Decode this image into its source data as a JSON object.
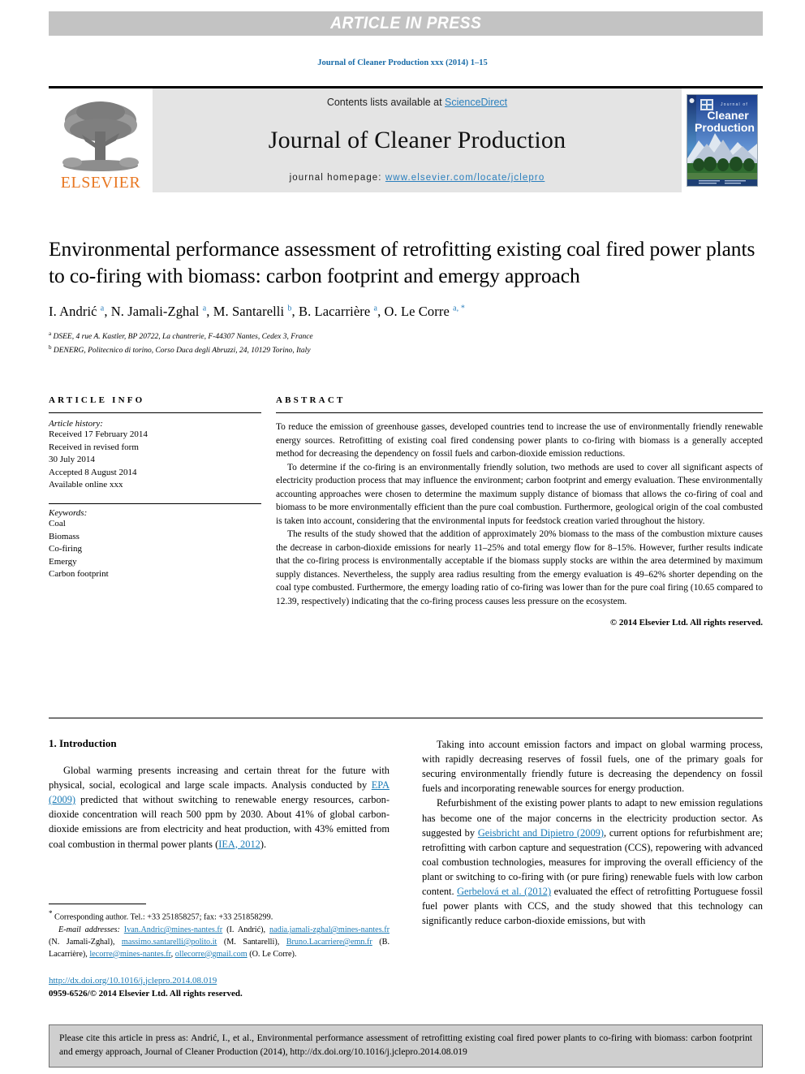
{
  "banner": {
    "label": "ARTICLE IN PRESS"
  },
  "running_head": "Journal of Cleaner Production xxx (2014) 1–15",
  "masthead": {
    "contents_prefix": "Contents lists available at ",
    "sciencedirect": "ScienceDirect",
    "journal_name": "Journal of Cleaner Production",
    "homepage_prefix": "journal homepage: ",
    "homepage_url": "www.elsevier.com/locate/jclepro",
    "publisher_logo_text": "ELSEVIER",
    "cover_title_small": "Journal of",
    "cover_title_line1": "Cleaner",
    "cover_title_line2": "Production"
  },
  "article": {
    "title": "Environmental performance assessment of retrofitting existing coal fired power plants to co-firing with biomass: carbon footprint and emergy approach",
    "authors_html": "I. Andrić <sup>a</sup>, N. Jamali-Zghal <sup>a</sup>, M. Santarelli <sup>b</sup>, B. Lacarrière <sup>a</sup>, O. Le Corre <sup>a, *</sup>",
    "affiliation_a": "DSEE, 4 rue A. Kastler, BP 20722, La chantrerie, F-44307 Nantes, Cedex 3, France",
    "affiliation_b": "DENERG, Politecnico di torino, Corso Duca degli Abruzzi, 24, 10129 Torino, Italy"
  },
  "article_info": {
    "heading": "ARTICLE INFO",
    "history_label": "Article history:",
    "history": [
      "Received 17 February 2014",
      "Received in revised form",
      "30 July 2014",
      "Accepted 8 August 2014",
      "Available online xxx"
    ],
    "keywords_label": "Keywords:",
    "keywords": [
      "Coal",
      "Biomass",
      "Co-firing",
      "Emergy",
      "Carbon footprint"
    ]
  },
  "abstract": {
    "heading": "ABSTRACT",
    "paragraphs": [
      "To reduce the emission of greenhouse gasses, developed countries tend to increase the use of environmentally friendly renewable energy sources. Retrofitting of existing coal fired condensing power plants to co-firing with biomass is a generally accepted method for decreasing the dependency on fossil fuels and carbon-dioxide emission reductions.",
      "To determine if the co-firing is an environmentally friendly solution, two methods are used to cover all significant aspects of electricity production process that may influence the environment; carbon footprint and emergy evaluation. These environmentally accounting approaches were chosen to determine the maximum supply distance of biomass that allows the co-firing of coal and biomass to be more environmentally efficient than the pure coal combustion. Furthermore, geological origin of the coal combusted is taken into account, considering that the environmental inputs for feedstock creation varied throughout the history.",
      "The results of the study showed that the addition of approximately 20% biomass to the mass of the combustion mixture causes the decrease in carbon-dioxide emissions for nearly 11–25% and total emergy flow for 8–15%. However, further results indicate that the co-firing process is environmentally acceptable if the biomass supply stocks are within the area determined by maximum supply distances. Nevertheless, the supply area radius resulting from the emergy evaluation is 49–62% shorter depending on the coal type combusted. Furthermore, the emergy loading ratio of co-firing was lower than for the pure coal firing (10.65 compared to 12.39, respectively) indicating that the co-firing process causes less pressure on the ecosystem."
    ],
    "copyright": "© 2014 Elsevier Ltd. All rights reserved."
  },
  "introduction": {
    "heading": "1. Introduction",
    "left_paragraph_parts": [
      "Global warming presents increasing and certain threat for the future with physical, social, ecological and large scale impacts. Analysis conducted by ",
      "EPA (2009)",
      " predicted that without switching to renewable energy resources, carbon-dioxide concentration will reach 500 ppm by 2030. About 41% of global carbon-dioxide emissions are from electricity and heat production, with 43% emitted from coal combustion in thermal power plants (",
      "IEA, 2012",
      ")."
    ],
    "right_paragraph_1": "Taking into account emission factors and impact on global warming process, with rapidly decreasing reserves of fossil fuels, one of the primary goals for securing environmentally friendly future is decreasing the dependency on fossil fuels and incorporating renewable sources for energy production.",
    "right_paragraph_2_parts": [
      "Refurbishment of the existing power plants to adapt to new emission regulations has become one of the major concerns in the electricity production sector. As suggested by ",
      "Geisbricht and Dipietro (2009)",
      ", current options for refurbishment are; retrofitting with carbon capture and sequestration (CCS), repowering with advanced coal combustion technologies, measures for improving the overall efficiency of the plant or switching to co-firing with (or pure firing) renewable fuels with low carbon content. ",
      "Gerbelová et al. (2012)",
      " evaluated the effect of retrofitting Portuguese fossil fuel power plants with CCS, and the study showed that this technology can significantly reduce carbon-dioxide emissions, but with"
    ]
  },
  "footnote": {
    "corresponding": "Corresponding author. Tel.: +33 251858257; fax: +33 251858299.",
    "email_label": "E-mail addresses:",
    "emails_parts": [
      "Ivan.Andric@mines-nantes.fr",
      " (I. Andrić), ",
      "nadia.jamali-zghal@mines-nantes.fr",
      " (N. Jamali-Zghal), ",
      "massimo.santarelli@polito.it",
      " (M. Santarelli), ",
      "Bruno.Lacarriere@emn.fr",
      " (B. Lacarrière), ",
      "lecorre@mines-nantes.fr",
      ", ",
      "ollecorre@gmail.com",
      " (O. Le Corre)."
    ],
    "doi": "http://dx.doi.org/10.1016/j.jclepro.2014.08.019",
    "issn_line": "0959-6526/© 2014 Elsevier Ltd. All rights reserved."
  },
  "citation_box": {
    "text": "Please cite this article in press as: Andrić, I., et al., Environmental performance assessment of retrofitting existing coal fired power plants to co-firing with biomass: carbon footprint and emergy approach, Journal of Cleaner Production (2014), http://dx.doi.org/10.1016/j.jclepro.2014.08.019"
  },
  "colors": {
    "banner_bg": "#c3c3c3",
    "link_blue": "#2a7fbd",
    "cite_blue": "#1a7ab5",
    "elsevier_orange": "#e87722",
    "masthead_bg": "#e4e4e4",
    "citebox_bg": "#cfcfcf"
  }
}
